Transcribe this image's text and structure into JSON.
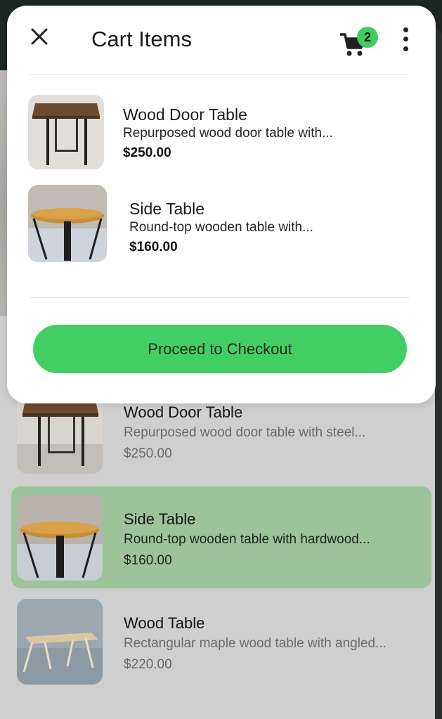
{
  "dialog": {
    "title": "Cart Items",
    "cart_count": "2",
    "items": [
      {
        "title": "Wood Door Table",
        "desc": "Repurposed wood door table with...",
        "price": "$250.00"
      },
      {
        "title": "Side Table",
        "desc": "Round-top wooden table with...",
        "price": "$160.00"
      }
    ],
    "checkout_label": "Proceed to Checkout"
  },
  "products": [
    {
      "title": "Wood Door Table",
      "desc": "Repurposed wood door table with steel...",
      "price": "$250.00",
      "selected": false
    },
    {
      "title": "Side Table",
      "desc": "Round-top wooden table with hardwood...",
      "price": "$160.00",
      "selected": true
    },
    {
      "title": "Wood Table",
      "desc": "Rectangular maple wood table with angled...",
      "price": "$220.00",
      "selected": false
    }
  ],
  "colors": {
    "accent": "#43ce64",
    "selected_row": "#9cc39a",
    "dialog_bg": "#ffffff",
    "scrim": "#cfcfcf"
  },
  "icons": [
    "close-icon",
    "cart-icon",
    "more-vertical-icon"
  ]
}
